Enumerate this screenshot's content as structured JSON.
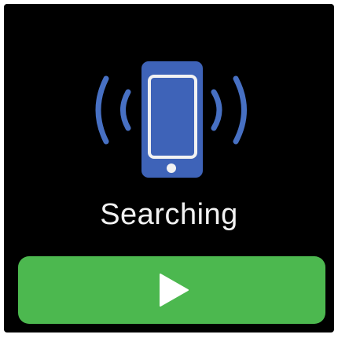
{
  "screen": {
    "background": "#000000",
    "status_text": "Searching",
    "icons": {
      "main": "phone-icon",
      "left_signal": "signal-waves-left-icon",
      "right_signal": "signal-waves-right-icon",
      "action": "play-icon"
    },
    "colors": {
      "phone_blue": "#3e63b8",
      "wave_blue": "#4770c3",
      "button_green": "#4cb84f",
      "text": "#f2f2f2"
    }
  },
  "action_button": {
    "icon": "play-icon",
    "color": "#4cb84f"
  }
}
